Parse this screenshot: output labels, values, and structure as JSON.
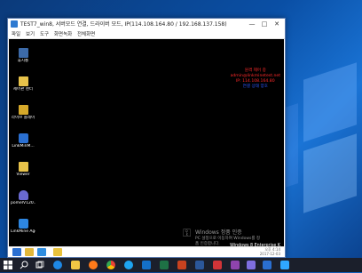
{
  "window": {
    "title": "TEST7_win8, 서버모드 연결, 드라이버 모드, IP(114.108.164.80 / 192.168.137.158)",
    "minimize": "—",
    "maximize": "□",
    "close": "✕"
  },
  "menu": {
    "items": [
      "파일",
      "보기",
      "도구",
      "화면녹화",
      "전체화면"
    ]
  },
  "desktop_icons": [
    {
      "label": "휴지통",
      "icon": "recycle-bin-icon"
    },
    {
      "label": "제어판 센터",
      "icon": "folder-icon"
    },
    {
      "label": "라이브 플레이",
      "icon": "folder-icon"
    },
    {
      "label": "LinkMinM...",
      "icon": "agent-icon"
    },
    {
      "label": "Viewer",
      "icon": "folder-icon"
    },
    {
      "label": "pomelV120...",
      "icon": "person-icon"
    },
    {
      "label": "LinkMine Agent",
      "icon": "agent-icon"
    }
  ],
  "overlay_info": {
    "line1": "원격 제어 중",
    "line2": "admin@linkminetest.net",
    "line3": "IP: 114.108.164.80",
    "line4": "연결 상태 양호"
  },
  "activation": {
    "title": "Windows 정품 인증",
    "line1": "PC 설정으로 이동하여 Windows를 정",
    "line2": "품 인증합니다."
  },
  "build": {
    "edition": "Windows 8 Enterprise K",
    "number": "Build 9200"
  },
  "inner_clock": {
    "time": "오후 4:14",
    "date": "2017-12-03"
  },
  "taskbar": {
    "items": [
      {
        "name": "start-button",
        "color": "#ffffff"
      },
      {
        "name": "search-icon",
        "color": "#ffffff"
      },
      {
        "name": "task-view-icon",
        "color": "#ffffff"
      },
      {
        "name": "edge-icon",
        "color": "#1e88e5"
      },
      {
        "name": "explorer-icon",
        "color": "#f2c744"
      },
      {
        "name": "app-icon",
        "color": "#ff7a1a"
      },
      {
        "name": "chrome-icon",
        "color": "#e94235"
      },
      {
        "name": "ie-icon",
        "color": "#1ea4f0"
      },
      {
        "name": "outlook-icon",
        "color": "#1470c7"
      },
      {
        "name": "excel-icon",
        "color": "#1e7145"
      },
      {
        "name": "powerpoint-icon",
        "color": "#c8421f"
      },
      {
        "name": "word-icon",
        "color": "#2b579a"
      },
      {
        "name": "app2-icon",
        "color": "#d13438"
      },
      {
        "name": "photos-icon",
        "color": "#8e44ad"
      },
      {
        "name": "app3-icon",
        "color": "#7f6fe0"
      },
      {
        "name": "app4-icon",
        "color": "#2a6fd1"
      },
      {
        "name": "remote-desktop-icon",
        "color": "#2fa7ff"
      }
    ]
  }
}
